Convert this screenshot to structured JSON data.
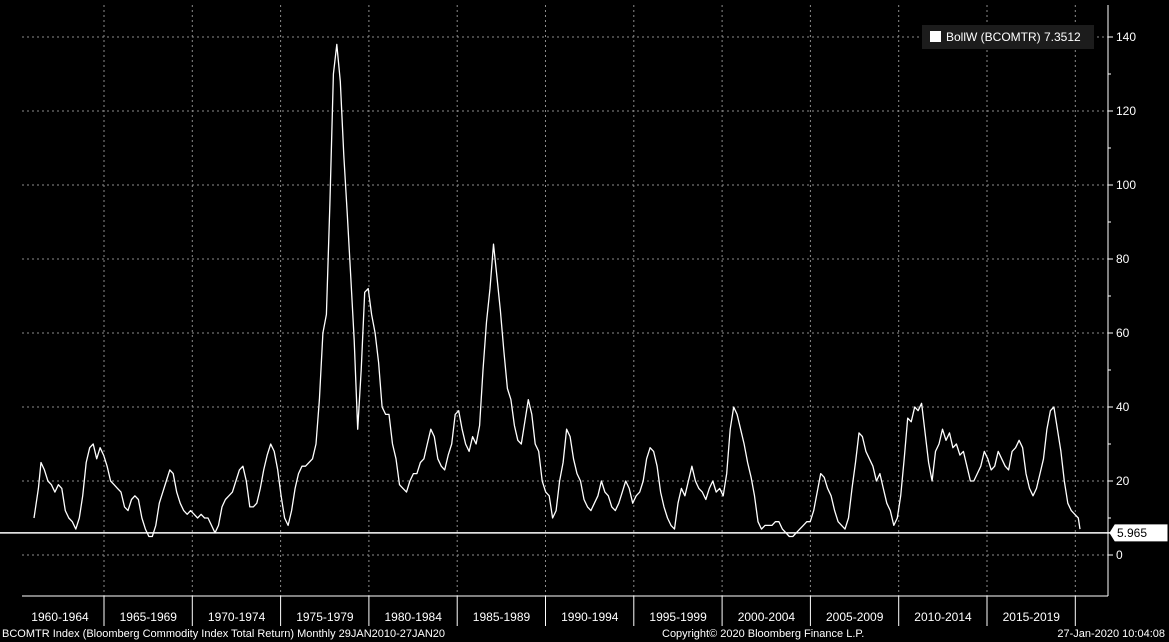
{
  "chart_data": {
    "type": "line",
    "title": "",
    "xlabel": "",
    "ylabel": "",
    "ylim": [
      -10,
      148
    ],
    "xlim": [
      1960.0,
      2020.1
    ],
    "grid": true,
    "legend_position": "top-right",
    "series": [
      {
        "name": "BollW (BCOMTR)",
        "color": "#ffffff",
        "points": [
          [
            1960.0,
            10
          ],
          [
            1960.25,
            18
          ],
          [
            1960.4,
            25
          ],
          [
            1960.6,
            23
          ],
          [
            1960.8,
            20
          ],
          [
            1961.0,
            19
          ],
          [
            1961.2,
            17
          ],
          [
            1961.4,
            19
          ],
          [
            1961.6,
            18
          ],
          [
            1961.8,
            12
          ],
          [
            1962.0,
            10
          ],
          [
            1962.2,
            9
          ],
          [
            1962.4,
            7
          ],
          [
            1962.6,
            10
          ],
          [
            1962.8,
            16
          ],
          [
            1963.0,
            25
          ],
          [
            1963.2,
            29
          ],
          [
            1963.4,
            30
          ],
          [
            1963.6,
            26
          ],
          [
            1963.8,
            29
          ],
          [
            1964.0,
            27
          ],
          [
            1964.2,
            24
          ],
          [
            1964.4,
            20
          ],
          [
            1964.6,
            19
          ],
          [
            1964.8,
            18
          ],
          [
            1965.0,
            17
          ],
          [
            1965.2,
            13
          ],
          [
            1965.4,
            12
          ],
          [
            1965.6,
            15
          ],
          [
            1965.8,
            16
          ],
          [
            1966.0,
            15
          ],
          [
            1966.2,
            10
          ],
          [
            1966.4,
            7
          ],
          [
            1966.6,
            5
          ],
          [
            1966.8,
            5
          ],
          [
            1967.0,
            8
          ],
          [
            1967.2,
            14
          ],
          [
            1967.4,
            17
          ],
          [
            1967.6,
            20
          ],
          [
            1967.8,
            23
          ],
          [
            1968.0,
            22
          ],
          [
            1968.2,
            17
          ],
          [
            1968.4,
            14
          ],
          [
            1968.6,
            12
          ],
          [
            1968.8,
            11
          ],
          [
            1969.0,
            12
          ],
          [
            1969.2,
            11
          ],
          [
            1969.4,
            10
          ],
          [
            1969.6,
            11
          ],
          [
            1969.8,
            10
          ],
          [
            1970.0,
            10
          ],
          [
            1970.2,
            8
          ],
          [
            1970.4,
            6
          ],
          [
            1970.6,
            8
          ],
          [
            1970.8,
            13
          ],
          [
            1971.0,
            15
          ],
          [
            1971.2,
            16
          ],
          [
            1971.4,
            17
          ],
          [
            1971.6,
            20
          ],
          [
            1971.8,
            23
          ],
          [
            1972.0,
            24
          ],
          [
            1972.2,
            20
          ],
          [
            1972.4,
            13
          ],
          [
            1972.6,
            13
          ],
          [
            1972.8,
            14
          ],
          [
            1973.0,
            18
          ],
          [
            1973.2,
            23
          ],
          [
            1973.4,
            27
          ],
          [
            1973.6,
            30
          ],
          [
            1973.8,
            28
          ],
          [
            1974.0,
            23
          ],
          [
            1974.2,
            16
          ],
          [
            1974.4,
            10
          ],
          [
            1974.6,
            8
          ],
          [
            1974.8,
            12
          ],
          [
            1975.0,
            18
          ],
          [
            1975.2,
            22
          ],
          [
            1975.4,
            24
          ],
          [
            1975.6,
            24
          ],
          [
            1975.8,
            25
          ],
          [
            1976.0,
            26
          ],
          [
            1976.2,
            30
          ],
          [
            1976.4,
            42
          ],
          [
            1976.6,
            60
          ],
          [
            1976.8,
            65
          ],
          [
            1977.0,
            95
          ],
          [
            1977.2,
            130
          ],
          [
            1977.4,
            138
          ],
          [
            1977.6,
            128
          ],
          [
            1977.8,
            108
          ],
          [
            1978.0,
            92
          ],
          [
            1978.2,
            75
          ],
          [
            1978.4,
            58
          ],
          [
            1978.6,
            34
          ],
          [
            1978.8,
            50
          ],
          [
            1979.0,
            71
          ],
          [
            1979.2,
            72
          ],
          [
            1979.4,
            65
          ],
          [
            1979.6,
            60
          ],
          [
            1979.8,
            52
          ],
          [
            1980.0,
            40
          ],
          [
            1980.2,
            38
          ],
          [
            1980.4,
            38
          ],
          [
            1980.6,
            30
          ],
          [
            1980.8,
            26
          ],
          [
            1981.0,
            19
          ],
          [
            1981.2,
            18
          ],
          [
            1981.4,
            17
          ],
          [
            1981.6,
            20
          ],
          [
            1981.8,
            22
          ],
          [
            1982.0,
            22
          ],
          [
            1982.2,
            25
          ],
          [
            1982.4,
            26
          ],
          [
            1982.6,
            30
          ],
          [
            1982.8,
            34
          ],
          [
            1983.0,
            32
          ],
          [
            1983.2,
            26
          ],
          [
            1983.4,
            24
          ],
          [
            1983.6,
            23
          ],
          [
            1983.8,
            27
          ],
          [
            1984.0,
            30
          ],
          [
            1984.2,
            38
          ],
          [
            1984.4,
            39
          ],
          [
            1984.6,
            34
          ],
          [
            1984.8,
            30
          ],
          [
            1985.0,
            28
          ],
          [
            1985.2,
            32
          ],
          [
            1985.4,
            30
          ],
          [
            1985.6,
            35
          ],
          [
            1985.8,
            50
          ],
          [
            1986.0,
            63
          ],
          [
            1986.2,
            72
          ],
          [
            1986.4,
            84
          ],
          [
            1986.6,
            75
          ],
          [
            1986.8,
            66
          ],
          [
            1987.0,
            55
          ],
          [
            1987.2,
            45
          ],
          [
            1987.4,
            42
          ],
          [
            1987.6,
            35
          ],
          [
            1987.8,
            31
          ],
          [
            1988.0,
            30
          ],
          [
            1988.2,
            36
          ],
          [
            1988.4,
            42
          ],
          [
            1988.6,
            38
          ],
          [
            1988.8,
            30
          ],
          [
            1989.0,
            28
          ],
          [
            1989.2,
            20
          ],
          [
            1989.4,
            17
          ],
          [
            1989.6,
            16
          ],
          [
            1989.8,
            10
          ],
          [
            1990.0,
            12
          ],
          [
            1990.2,
            20
          ],
          [
            1990.4,
            25
          ],
          [
            1990.6,
            34
          ],
          [
            1990.8,
            32
          ],
          [
            1991.0,
            26
          ],
          [
            1991.2,
            22
          ],
          [
            1991.4,
            20
          ],
          [
            1991.6,
            15
          ],
          [
            1991.8,
            13
          ],
          [
            1992.0,
            12
          ],
          [
            1992.2,
            14
          ],
          [
            1992.4,
            16
          ],
          [
            1992.6,
            20
          ],
          [
            1992.8,
            17
          ],
          [
            1993.0,
            16
          ],
          [
            1993.2,
            13
          ],
          [
            1993.4,
            12
          ],
          [
            1993.6,
            14
          ],
          [
            1993.8,
            17
          ],
          [
            1994.0,
            20
          ],
          [
            1994.2,
            18
          ],
          [
            1994.4,
            14
          ],
          [
            1994.6,
            16
          ],
          [
            1994.8,
            17
          ],
          [
            1995.0,
            20
          ],
          [
            1995.2,
            26
          ],
          [
            1995.4,
            29
          ],
          [
            1995.6,
            28
          ],
          [
            1995.8,
            24
          ],
          [
            1996.0,
            17
          ],
          [
            1996.2,
            13
          ],
          [
            1996.4,
            10
          ],
          [
            1996.6,
            8
          ],
          [
            1996.8,
            7
          ],
          [
            1997.0,
            14
          ],
          [
            1997.2,
            18
          ],
          [
            1997.4,
            16
          ],
          [
            1997.6,
            20
          ],
          [
            1997.8,
            24
          ],
          [
            1998.0,
            20
          ],
          [
            1998.2,
            18
          ],
          [
            1998.4,
            17
          ],
          [
            1998.6,
            15
          ],
          [
            1998.8,
            18
          ],
          [
            1999.0,
            20
          ],
          [
            1999.2,
            17
          ],
          [
            1999.4,
            18
          ],
          [
            1999.6,
            16
          ],
          [
            1999.8,
            22
          ],
          [
            2000.0,
            34
          ],
          [
            2000.2,
            40
          ],
          [
            2000.4,
            38
          ],
          [
            2000.6,
            34
          ],
          [
            2000.8,
            30
          ],
          [
            2001.0,
            25
          ],
          [
            2001.2,
            21
          ],
          [
            2001.4,
            16
          ],
          [
            2001.6,
            9
          ],
          [
            2001.8,
            7
          ],
          [
            2002.0,
            8
          ],
          [
            2002.2,
            8
          ],
          [
            2002.4,
            8
          ],
          [
            2002.6,
            9
          ],
          [
            2002.8,
            9
          ],
          [
            2003.0,
            7
          ],
          [
            2003.2,
            6
          ],
          [
            2003.4,
            5
          ],
          [
            2003.6,
            5
          ],
          [
            2003.8,
            6
          ],
          [
            2004.0,
            7
          ],
          [
            2004.2,
            8
          ],
          [
            2004.4,
            9
          ],
          [
            2004.6,
            9
          ],
          [
            2004.8,
            12
          ],
          [
            2005.0,
            17
          ],
          [
            2005.2,
            22
          ],
          [
            2005.4,
            21
          ],
          [
            2005.6,
            18
          ],
          [
            2005.8,
            16
          ],
          [
            2006.0,
            12
          ],
          [
            2006.2,
            9
          ],
          [
            2006.4,
            8
          ],
          [
            2006.6,
            7
          ],
          [
            2006.8,
            10
          ],
          [
            2007.0,
            18
          ],
          [
            2007.2,
            25
          ],
          [
            2007.4,
            33
          ],
          [
            2007.6,
            32
          ],
          [
            2007.8,
            28
          ],
          [
            2008.0,
            26
          ],
          [
            2008.2,
            24
          ],
          [
            2008.4,
            20
          ],
          [
            2008.6,
            22
          ],
          [
            2008.8,
            18
          ],
          [
            2009.0,
            14
          ],
          [
            2009.2,
            12
          ],
          [
            2009.4,
            8
          ],
          [
            2009.6,
            10
          ],
          [
            2009.8,
            16
          ],
          [
            2010.0,
            26
          ],
          [
            2010.2,
            37
          ],
          [
            2010.4,
            36
          ],
          [
            2010.6,
            40
          ],
          [
            2010.8,
            39
          ],
          [
            2011.0,
            41
          ],
          [
            2011.2,
            33
          ],
          [
            2011.4,
            25
          ],
          [
            2011.6,
            20
          ],
          [
            2011.8,
            28
          ],
          [
            2012.0,
            30
          ],
          [
            2012.2,
            34
          ],
          [
            2012.4,
            31
          ],
          [
            2012.6,
            33
          ],
          [
            2012.8,
            29
          ],
          [
            2013.0,
            30
          ],
          [
            2013.2,
            27
          ],
          [
            2013.4,
            28
          ],
          [
            2013.6,
            24
          ],
          [
            2013.8,
            20
          ],
          [
            2014.0,
            20
          ],
          [
            2014.2,
            22
          ],
          [
            2014.4,
            24
          ],
          [
            2014.6,
            28
          ],
          [
            2014.8,
            26
          ],
          [
            2015.0,
            23
          ],
          [
            2015.2,
            24
          ],
          [
            2015.4,
            28
          ],
          [
            2015.6,
            26
          ],
          [
            2015.8,
            24
          ],
          [
            2016.0,
            23
          ],
          [
            2016.2,
            28
          ],
          [
            2016.4,
            29
          ],
          [
            2016.6,
            31
          ],
          [
            2016.8,
            29
          ],
          [
            2017.0,
            22
          ],
          [
            2017.2,
            18
          ],
          [
            2017.4,
            16
          ],
          [
            2017.6,
            18
          ],
          [
            2017.8,
            22
          ],
          [
            2018.0,
            26
          ],
          [
            2018.2,
            34
          ],
          [
            2018.4,
            39
          ],
          [
            2018.6,
            40
          ],
          [
            2018.8,
            34
          ],
          [
            2019.0,
            28
          ],
          [
            2019.2,
            20
          ],
          [
            2019.4,
            14
          ],
          [
            2019.6,
            12
          ],
          [
            2019.8,
            11
          ],
          [
            2020.0,
            10
          ],
          [
            2020.1,
            7
          ]
        ]
      }
    ],
    "legend_entries": [
      {
        "label": "BollW (BCOMTR)",
        "value": "7.3512",
        "color": "#ffffff"
      }
    ],
    "horizontal_line": {
      "value": 5.965,
      "label": "5.965",
      "color": "#ffffff"
    },
    "y_ticks": [
      0,
      20,
      40,
      60,
      80,
      100,
      120,
      140
    ],
    "x_categories": [
      "1960-1964",
      "1965-1969",
      "1970-1974",
      "1975-1979",
      "1980-1984",
      "1985-1989",
      "1990-1994",
      "1995-1999",
      "2000-2004",
      "2005-2009",
      "2010-2014",
      "2015-2019"
    ]
  },
  "footer": {
    "left": "BCOMTR Index (Bloomberg Commodity Index Total Return)  Monthly 29JAN2010-27JAN20",
    "middle": "Copyright© 2020 Bloomberg Finance L.P.",
    "right": "27-Jan-2020 10:04:08"
  },
  "colors": {
    "background": "#000000",
    "line": "#ffffff",
    "grid": "#8c8c8c",
    "legend_box": "#1c1c1c"
  }
}
